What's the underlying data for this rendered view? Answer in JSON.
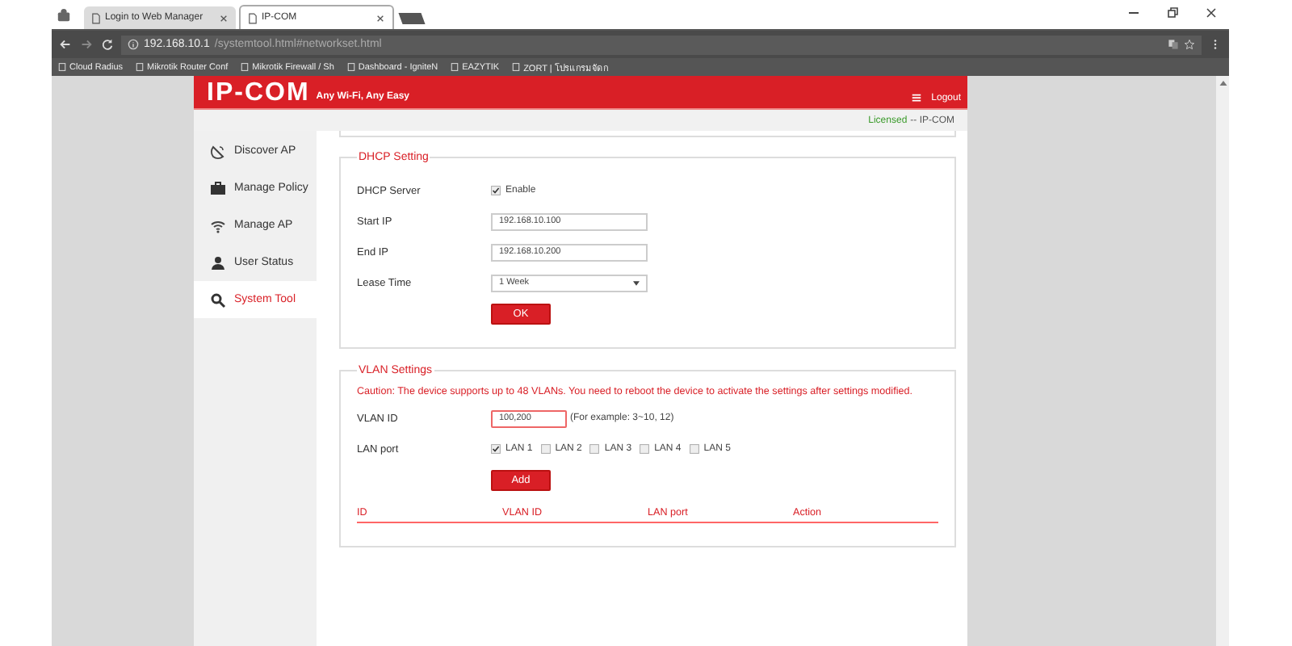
{
  "browser": {
    "tabs": [
      {
        "title": "Login to Web Manager",
        "selected": false
      },
      {
        "title": "IP-COM",
        "selected": true
      }
    ],
    "address": {
      "host": "192.168.10.1",
      "path": "/systemtool.html#networkset.html"
    },
    "bookmarks": [
      {
        "label": "Cloud Radius"
      },
      {
        "label": "Mikrotik Router Conf"
      },
      {
        "label": "Mikrotik Firewall / Sh"
      },
      {
        "label": "Dashboard - IgniteN"
      },
      {
        "label": "EAZYTIK"
      },
      {
        "label": "ZORT | โปรแกรมจัดก"
      }
    ]
  },
  "header": {
    "logo": "IP-COM",
    "tagline": "Any Wi-Fi, Any Easy",
    "logout": "Logout",
    "license_status": "Licensed",
    "license_product": "-- IP-COM"
  },
  "sidebar": {
    "items": [
      {
        "label": "Discover AP",
        "selected": false
      },
      {
        "label": "Manage Policy",
        "selected": false
      },
      {
        "label": "Manage AP",
        "selected": false
      },
      {
        "label": "User Status",
        "selected": false
      },
      {
        "label": "System Tool",
        "selected": true
      }
    ]
  },
  "dhcp": {
    "title": "DHCP Setting",
    "server_label": "DHCP Server",
    "enable_label": "Enable",
    "enabled": true,
    "fields": [
      {
        "label": "Start IP",
        "value": "192.168.10.100",
        "kind": "text"
      },
      {
        "label": "End IP",
        "value": "192.168.10.200",
        "kind": "text"
      },
      {
        "label": "Lease Time",
        "value": "1 Week",
        "kind": "select"
      }
    ],
    "ok": "OK"
  },
  "vlan": {
    "title": "VLAN Settings",
    "caution": "Caution: The device supports up to 48 VLANs. You need to reboot the device to activate the settings after settings modified.",
    "vlan_id_label": "VLAN ID",
    "vlan_id_value": "100,200",
    "hint": "(For example: 3~10, 12)",
    "lan_label": "LAN port",
    "ports": [
      {
        "label": "LAN 1",
        "checked": true
      },
      {
        "label": "LAN 2",
        "checked": false
      },
      {
        "label": "LAN 3",
        "checked": false
      },
      {
        "label": "LAN 4",
        "checked": false
      },
      {
        "label": "LAN 5",
        "checked": false
      }
    ],
    "add": "Add",
    "columns": [
      "ID",
      "VLAN ID",
      "LAN port",
      "Action"
    ]
  }
}
